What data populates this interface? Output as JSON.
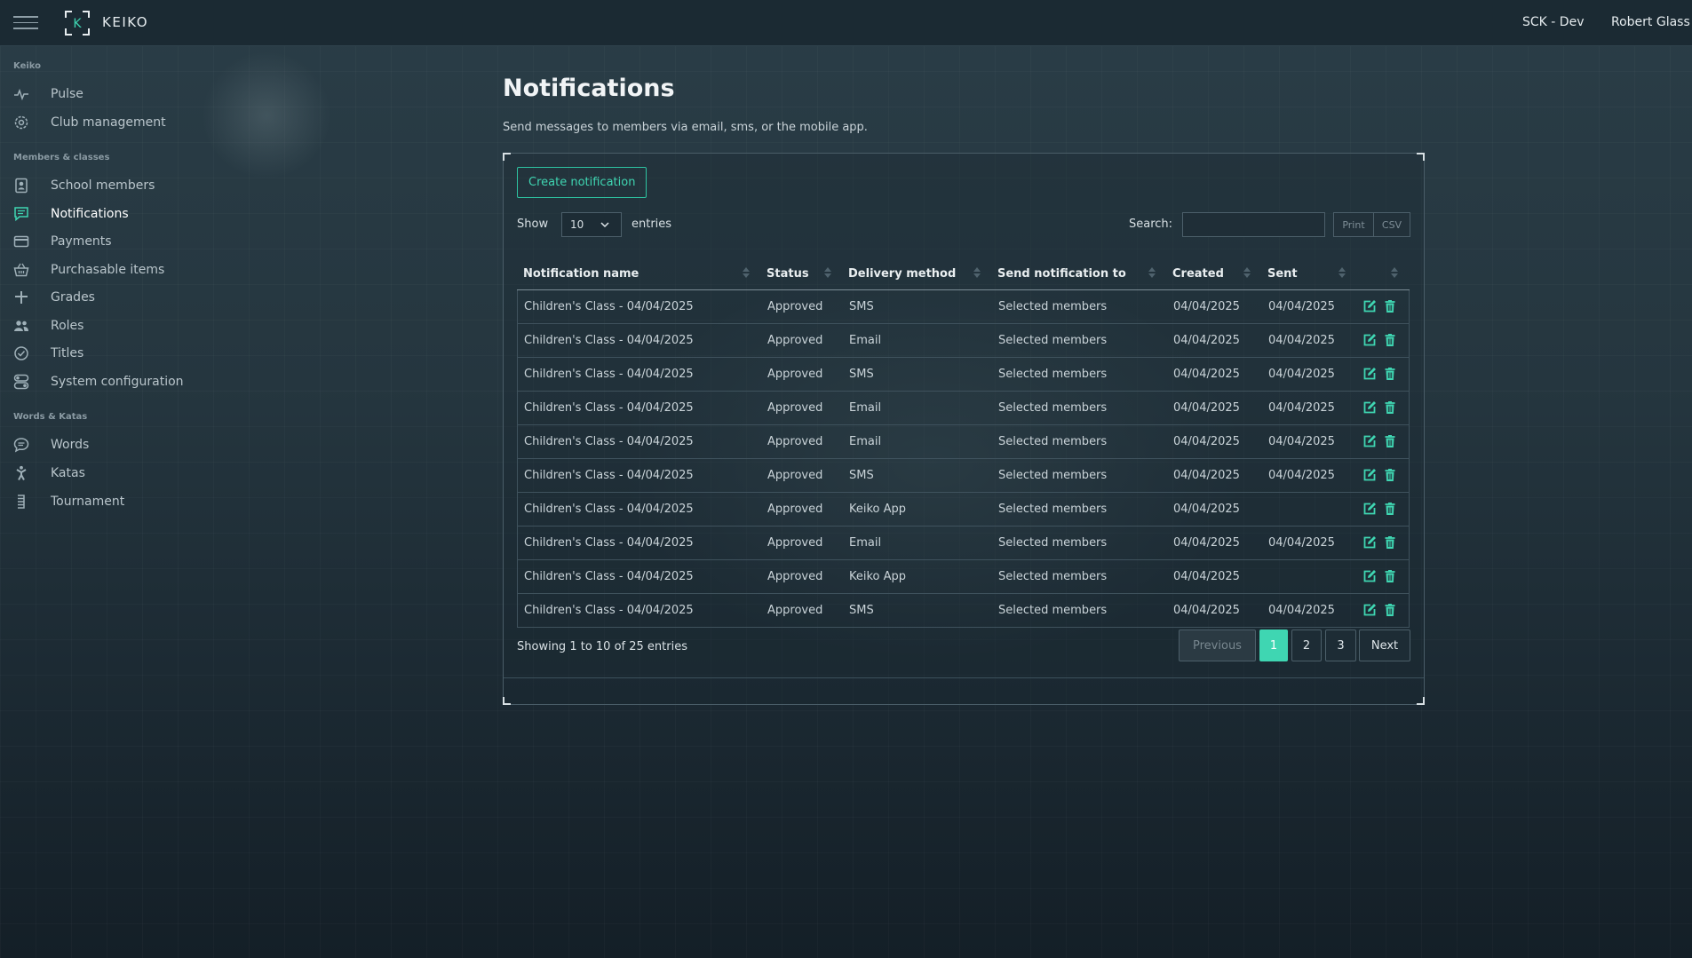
{
  "topbar": {
    "brand": "KEIKO",
    "logo_letter": "K",
    "org": "SCK - Dev",
    "user": "Robert Glass"
  },
  "sidebar": {
    "sections": [
      {
        "title": "Keiko",
        "items": [
          {
            "label": "Pulse",
            "icon": "pulse-icon"
          },
          {
            "label": "Club management",
            "icon": "gear-icon"
          }
        ]
      },
      {
        "title": "Members & classes",
        "items": [
          {
            "label": "School members",
            "icon": "id-badge-icon"
          },
          {
            "label": "Notifications",
            "icon": "chat-icon",
            "active": true
          },
          {
            "label": "Payments",
            "icon": "credit-card-icon"
          },
          {
            "label": "Purchasable items",
            "icon": "basket-icon"
          },
          {
            "label": "Grades",
            "icon": "plus-icon"
          },
          {
            "label": "Roles",
            "icon": "users-icon"
          },
          {
            "label": "Titles",
            "icon": "check-circle-icon"
          },
          {
            "label": "System configuration",
            "icon": "toggles-icon"
          }
        ]
      },
      {
        "title": "Words & Katas",
        "items": [
          {
            "label": "Words",
            "icon": "speech-bubble-icon"
          },
          {
            "label": "Katas",
            "icon": "figure-icon"
          },
          {
            "label": "Tournament",
            "icon": "bracket-icon"
          }
        ]
      }
    ]
  },
  "main": {
    "title": "Notifications",
    "description": "Send messages to members via email, sms, or the mobile app.",
    "create_button": "Create notification",
    "show_label": "Show",
    "page_length": "10",
    "entries_label": "entries",
    "search_label": "Search:",
    "search_value": "",
    "print_label": "Print",
    "csv_label": "CSV",
    "columns": [
      "Notification name",
      "Status",
      "Delivery method",
      "Send notification to",
      "Created",
      "Sent"
    ],
    "rows": [
      {
        "name": "Children's Class - 04/04/2025",
        "status": "Approved",
        "method": "SMS",
        "to": "Selected members",
        "created": "04/04/2025",
        "sent": "04/04/2025"
      },
      {
        "name": "Children's Class - 04/04/2025",
        "status": "Approved",
        "method": "Email",
        "to": "Selected members",
        "created": "04/04/2025",
        "sent": "04/04/2025"
      },
      {
        "name": "Children's Class - 04/04/2025",
        "status": "Approved",
        "method": "SMS",
        "to": "Selected members",
        "created": "04/04/2025",
        "sent": "04/04/2025"
      },
      {
        "name": "Children's Class - 04/04/2025",
        "status": "Approved",
        "method": "Email",
        "to": "Selected members",
        "created": "04/04/2025",
        "sent": "04/04/2025"
      },
      {
        "name": "Children's Class - 04/04/2025",
        "status": "Approved",
        "method": "Email",
        "to": "Selected members",
        "created": "04/04/2025",
        "sent": "04/04/2025"
      },
      {
        "name": "Children's Class - 04/04/2025",
        "status": "Approved",
        "method": "SMS",
        "to": "Selected members",
        "created": "04/04/2025",
        "sent": "04/04/2025"
      },
      {
        "name": "Children's Class - 04/04/2025",
        "status": "Approved",
        "method": "Keiko App",
        "to": "Selected members",
        "created": "04/04/2025",
        "sent": ""
      },
      {
        "name": "Children's Class - 04/04/2025",
        "status": "Approved",
        "method": "Email",
        "to": "Selected members",
        "created": "04/04/2025",
        "sent": "04/04/2025"
      },
      {
        "name": "Children's Class - 04/04/2025",
        "status": "Approved",
        "method": "Keiko App",
        "to": "Selected members",
        "created": "04/04/2025",
        "sent": ""
      },
      {
        "name": "Children's Class - 04/04/2025",
        "status": "Approved",
        "method": "SMS",
        "to": "Selected members",
        "created": "04/04/2025",
        "sent": "04/04/2025"
      }
    ],
    "info": "Showing 1 to 10 of 25 entries",
    "pagination": {
      "previous": "Previous",
      "pages": [
        "1",
        "2",
        "3"
      ],
      "current": "1",
      "next": "Next"
    }
  },
  "colors": {
    "accent": "#3fd6b2",
    "topbar": "#1b2a33",
    "text": "#dfe6ea"
  }
}
